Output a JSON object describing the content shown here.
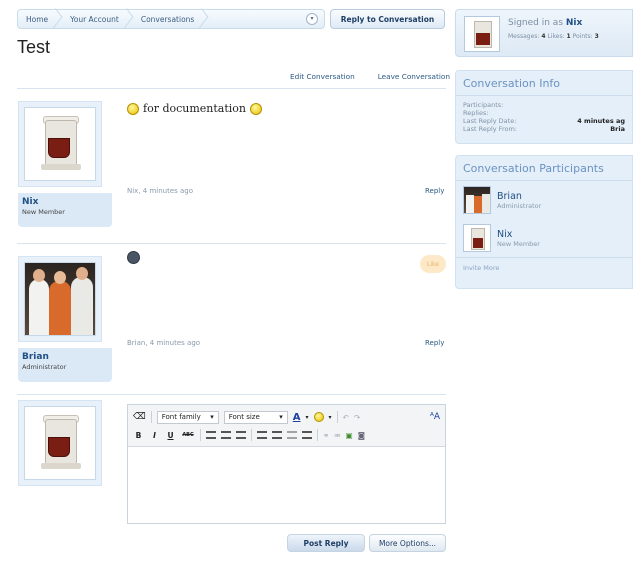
{
  "breadcrumb": {
    "items": [
      "Home",
      "Your Account",
      "Conversations"
    ]
  },
  "actions": {
    "reply_to_conversation": "Reply to Conversation",
    "edit_conversation": "Edit Conversation",
    "leave_conversation": "Leave Conversation"
  },
  "page": {
    "title": "Test"
  },
  "messages": [
    {
      "author": "Nix",
      "role": "New Member",
      "text": "for documentation",
      "meta": "Nix, 4 minutes ago",
      "reply": "Reply"
    },
    {
      "author": "Brian",
      "role": "Administrator",
      "text": "",
      "meta": "Brian, 4 minutes ago",
      "reply": "Reply",
      "like": "Like"
    }
  ],
  "signed_in": {
    "prefix": "Signed in as",
    "name": "Nix",
    "messages_label": "Messages:",
    "messages": "4",
    "likes_label": "Likes:",
    "likes": "1",
    "points_label": "Points:",
    "points": "3"
  },
  "conversation_info": {
    "title": "Conversation Info",
    "rows": [
      {
        "label": "Participants:",
        "value": ""
      },
      {
        "label": "Replies:",
        "value": ""
      },
      {
        "label": "Last Reply Date:",
        "value": "4 minutes ag"
      },
      {
        "label": "Last Reply From:",
        "value": "Bria"
      }
    ]
  },
  "participants_panel": {
    "title": "Conversation Participants",
    "people": [
      {
        "name": "Brian",
        "role": "Administrator"
      },
      {
        "name": "Nix",
        "role": "New Member"
      }
    ],
    "invite": "Invite More"
  },
  "editor": {
    "font_family": "Font family",
    "font_size": "Font size",
    "post_reply": "Post Reply",
    "more_options": "More Options..."
  }
}
